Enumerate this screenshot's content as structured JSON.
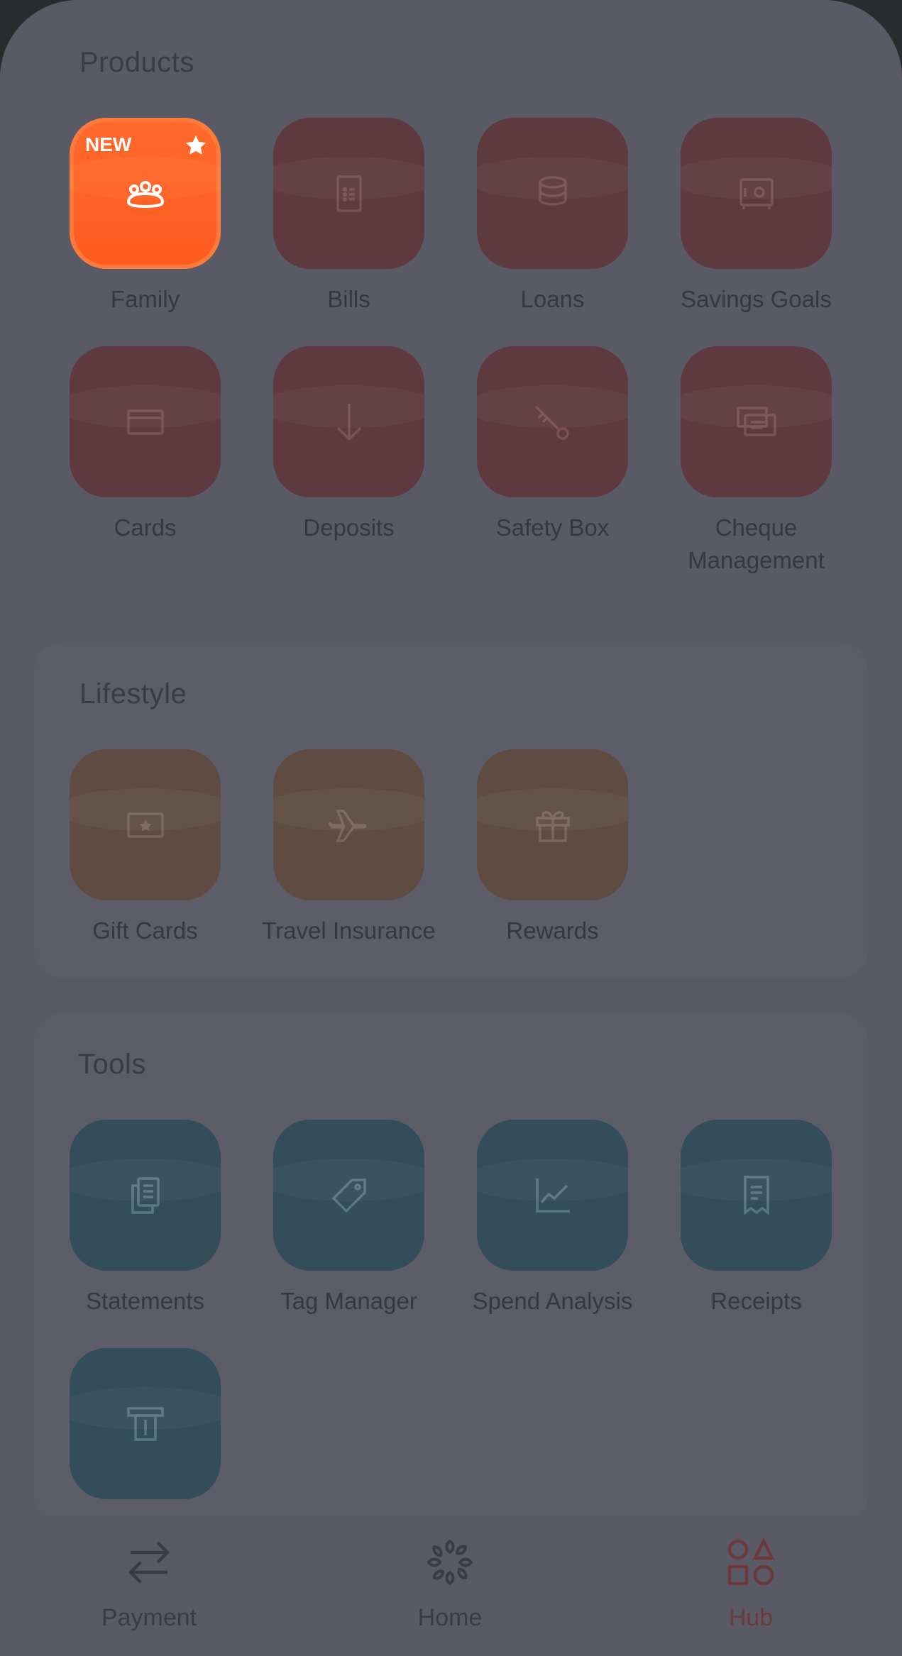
{
  "sections": {
    "products": {
      "title": "Products",
      "items": [
        {
          "label": "Family",
          "badge": "NEW",
          "icon": "family-icon"
        },
        {
          "label": "Bills",
          "icon": "bill-icon"
        },
        {
          "label": "Loans",
          "icon": "coins-icon"
        },
        {
          "label": "Savings Goals",
          "icon": "safe-icon"
        },
        {
          "label": "Cards",
          "icon": "card-icon"
        },
        {
          "label": "Deposits",
          "icon": "arrow-down-icon"
        },
        {
          "label": "Safety Box",
          "icon": "key-icon"
        },
        {
          "label": "Cheque\nManagement",
          "icon": "cheque-icon"
        }
      ]
    },
    "lifestyle": {
      "title": "Lifestyle",
      "items": [
        {
          "label": "Gift Cards",
          "icon": "gift-card-icon"
        },
        {
          "label": "Travel Insurance",
          "icon": "plane-icon"
        },
        {
          "label": "Rewards",
          "icon": "gift-icon"
        }
      ]
    },
    "tools": {
      "title": "Tools",
      "items": [
        {
          "label": "Statements",
          "icon": "statements-icon"
        },
        {
          "label": "Tag Manager",
          "icon": "tag-icon"
        },
        {
          "label": "Spend Analysis",
          "icon": "chart-icon"
        },
        {
          "label": "Receipts",
          "icon": "receipt-icon"
        },
        {
          "label": "",
          "icon": "atm-icon"
        }
      ]
    }
  },
  "nav": {
    "payment": "Payment",
    "home": "Home",
    "hub": "Hub"
  },
  "colors": {
    "products_tile": "#5e3a40",
    "lifestyle_tile": "#5f4b42",
    "tools_tile": "#344d5a",
    "highlight_tile": "#ff5a1f",
    "active_nav": "#6d3a3c"
  }
}
